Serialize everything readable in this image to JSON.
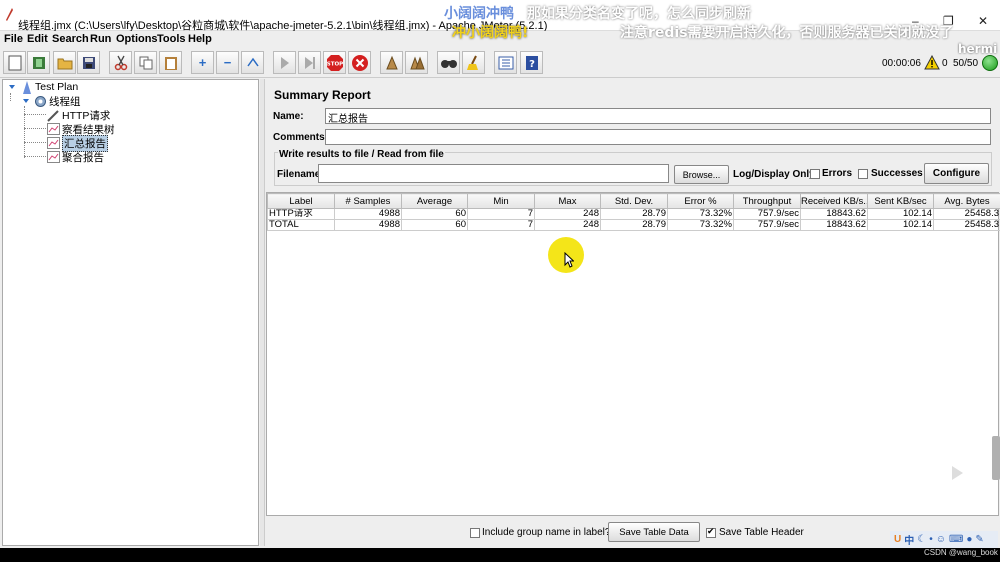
{
  "window": {
    "title": "线程组.jmx (C:\\Users\\lfy\\Desktop\\谷粒商城\\软件\\apache-jmeter-5.2.1\\bin\\线程组.jmx) - Apache JMeter (5.2.1)",
    "minimize": "–",
    "maximize": "❐",
    "close": "✕"
  },
  "overlay": {
    "line1_blue": "小阔阔冲鸭",
    "line1_white": "那如果分类名变了呢，怎么同步刷新",
    "line2_yellow": "冲小阔阔鸭!",
    "line2_white": "注意redis需要开启持久化，否则服务器已关闭就没了",
    "corner": "hermi"
  },
  "menu": [
    "File",
    "Edit",
    "Search",
    "Run",
    "Options",
    "Tools",
    "Help"
  ],
  "status": {
    "time": "00:00:06",
    "errors": "0",
    "threads": "50/50"
  },
  "tree": {
    "nodes": [
      "Test Plan",
      "线程组",
      "HTTP请求",
      "察看结果树",
      "汇总报告",
      "聚合报告"
    ]
  },
  "report": {
    "title": "Summary Report",
    "name_label": "Name:",
    "name_value": "汇总报告",
    "comments_label": "Comments:",
    "comments_value": "",
    "write_title": "Write results to file / Read from file",
    "filename_label": "Filename",
    "filename_value": "",
    "browse": "Browse...",
    "log_display": "Log/Display Only:",
    "errors": "Errors",
    "successes": "Successes",
    "configure": "Configure"
  },
  "table": {
    "headers": [
      "Label",
      "# Samples",
      "Average",
      "Min",
      "Max",
      "Std. Dev.",
      "Error %",
      "Throughput",
      "Received KB/s...",
      "Sent KB/sec",
      "Avg. Bytes"
    ],
    "rows": [
      [
        "HTTP请求",
        "4988",
        "60",
        "7",
        "248",
        "28.79",
        "73.32%",
        "757.9/sec",
        "18843.62",
        "102.14",
        "25458.3"
      ],
      [
        "TOTAL",
        "4988",
        "60",
        "7",
        "248",
        "28.79",
        "73.32%",
        "757.9/sec",
        "18843.62",
        "102.14",
        "25458.3"
      ]
    ]
  },
  "bottom": {
    "include_group": "Include group name in label?",
    "save_table": "Save Table Data",
    "save_header": "Save Table Header"
  },
  "tray": {
    "lang": "中"
  },
  "watermark": "CSDN @wang_book",
  "colors": {
    "selection": "#b8cfe5",
    "run_indicator": "#1a9a1a",
    "stop": "#d42020"
  }
}
